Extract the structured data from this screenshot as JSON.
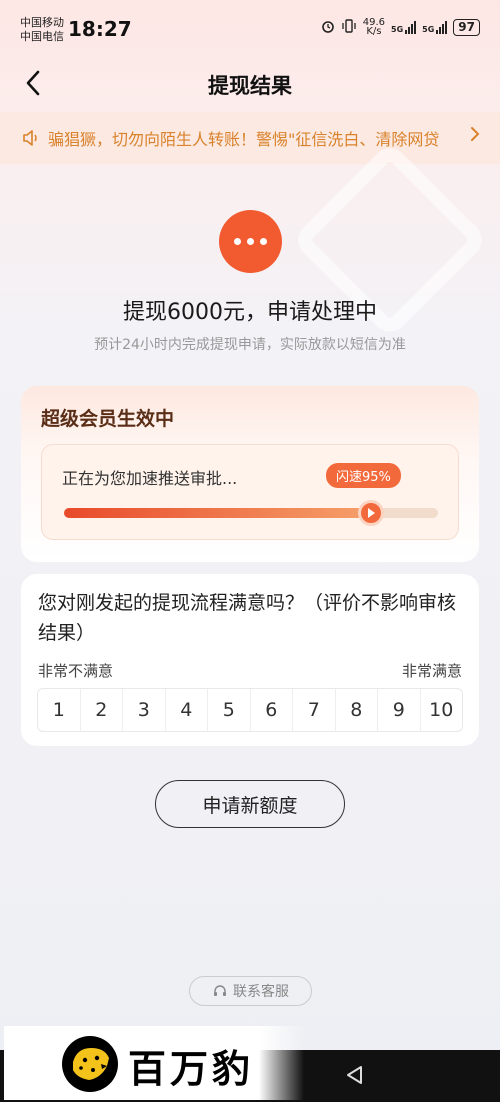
{
  "status_bar": {
    "carrier1": "中国移动",
    "carrier2": "中国电信",
    "time": "18:27",
    "net_speed_top": "49.6",
    "net_speed_unit": "K/s",
    "net_type1": "5G",
    "net_type2": "5G",
    "battery": "97"
  },
  "header": {
    "title": "提现结果"
  },
  "notice": {
    "text": "骗猖獗，切勿向陌生人转账！警惕\"征信洗白、清除网贷"
  },
  "result": {
    "title": "提现6000元，申请处理中",
    "subtitle": "预计24小时内完成提现申请，实际放款以短信为准"
  },
  "vip": {
    "title": "超级会员生效中",
    "progress_text": "正在为您加速推送审批...",
    "badge": "闪速95%",
    "progress": 0.82
  },
  "survey": {
    "question": "您对刚发起的提现流程满意吗？（评价不影响审核结果）",
    "min_label": "非常不满意",
    "max_label": "非常满意",
    "options": [
      "1",
      "2",
      "3",
      "4",
      "5",
      "6",
      "7",
      "8",
      "9",
      "10"
    ]
  },
  "actions": {
    "apply_new": "申请新额度",
    "contact": "联系客服"
  },
  "watermark": {
    "text": "百万豹"
  },
  "colors": {
    "accent": "#f25a30",
    "notice": "#d9822b"
  }
}
